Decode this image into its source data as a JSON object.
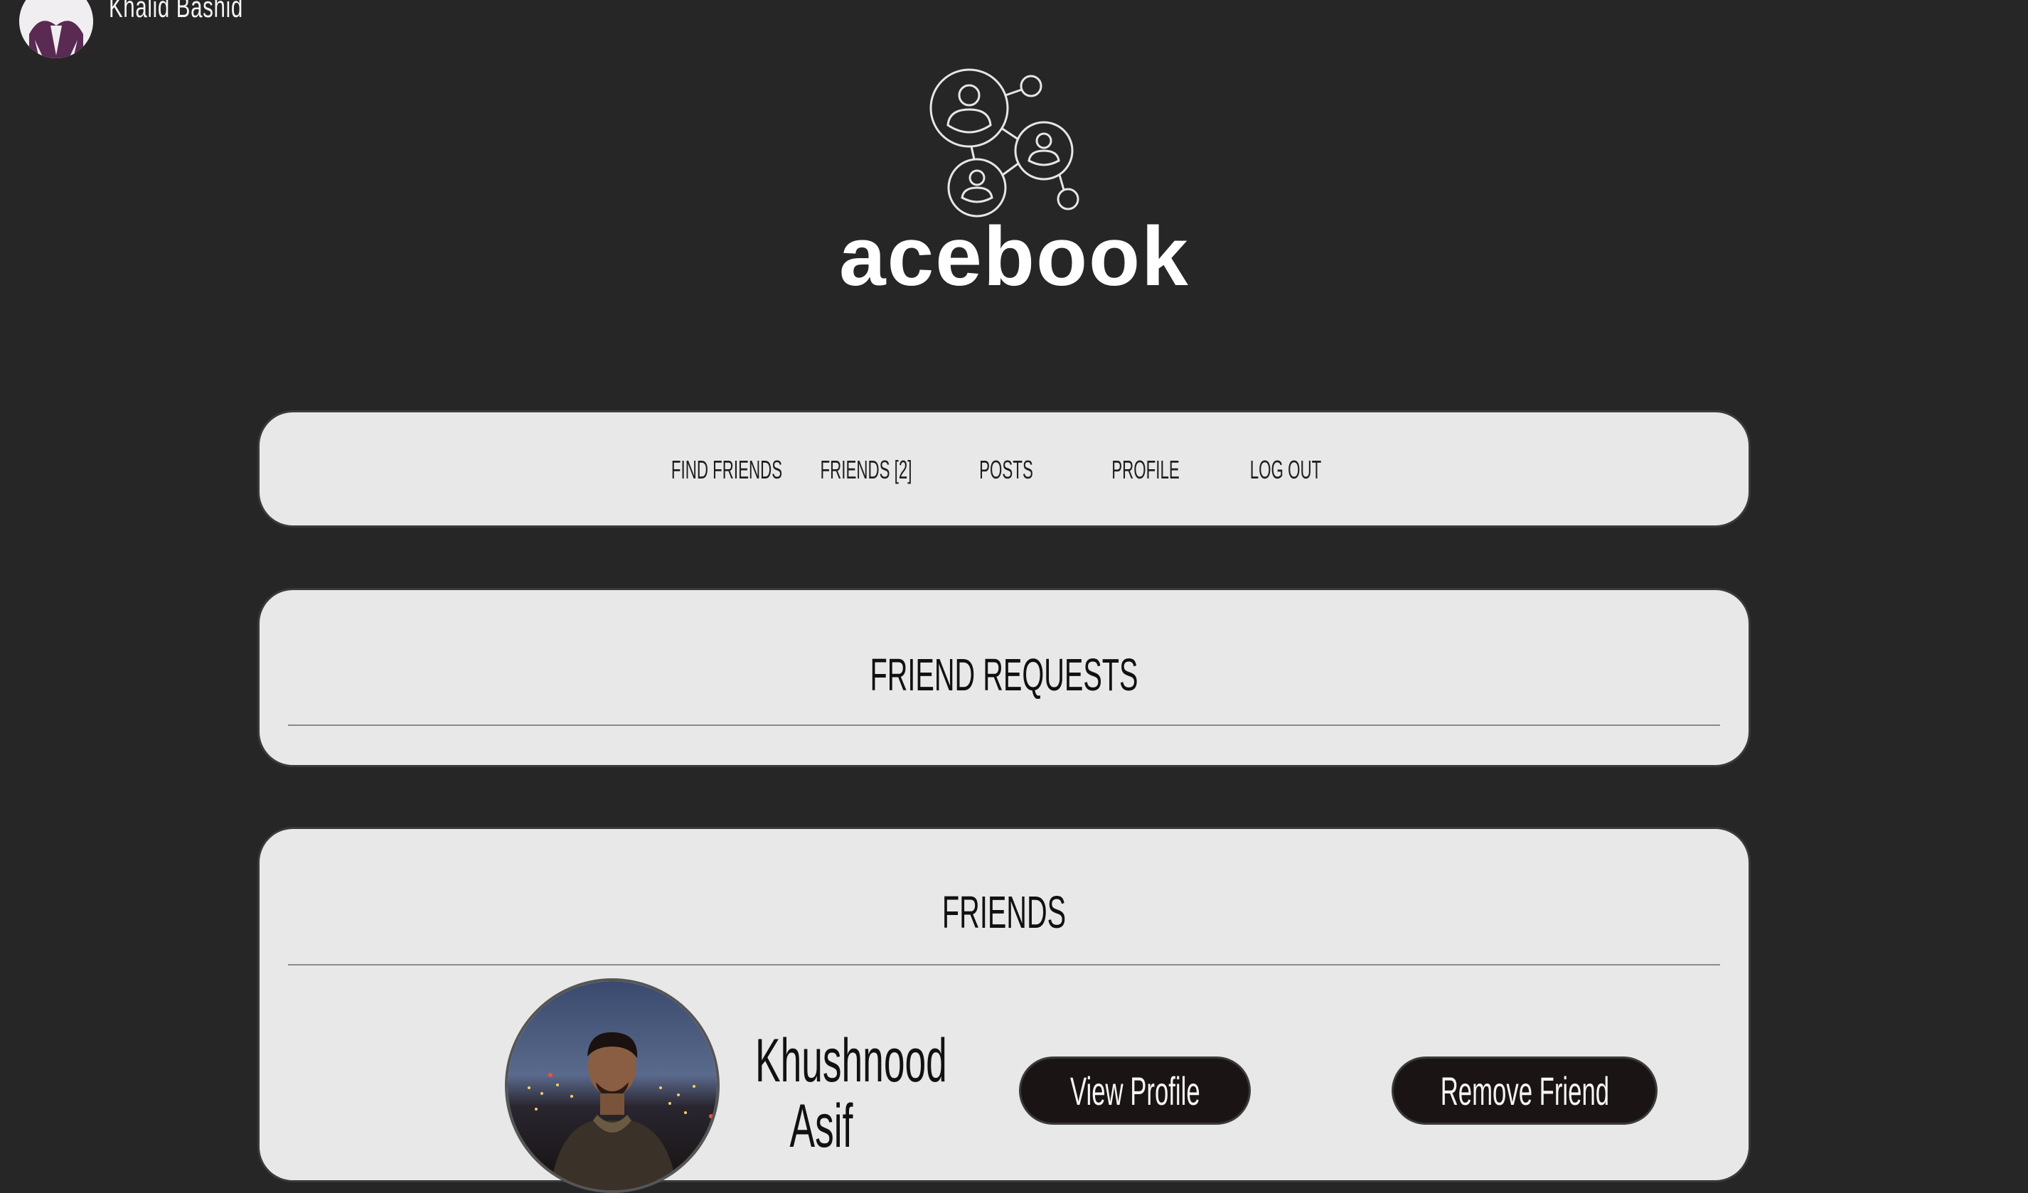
{
  "user": {
    "name": "Khalid Bashid",
    "avatar_icon": "user-avatar-icon"
  },
  "logo": {
    "icon": "social-network-icon",
    "text": "acebook"
  },
  "nav": {
    "items": [
      {
        "label": "FIND FRIENDS"
      },
      {
        "label": "FRIENDS [2]"
      },
      {
        "label": "POSTS"
      },
      {
        "label": "PROFILE"
      },
      {
        "label": "LOG OUT"
      }
    ]
  },
  "requests": {
    "title": "FRIEND REQUESTS"
  },
  "friends": {
    "title": "FRIENDS",
    "list": [
      {
        "name_line1": "Khushnood",
        "name_line2": "Asif",
        "view_label": "View Profile",
        "remove_label": "Remove Friend"
      }
    ]
  },
  "colors": {
    "background": "#262626",
    "panel": "#e8e8e8",
    "button": "#1b1414"
  }
}
